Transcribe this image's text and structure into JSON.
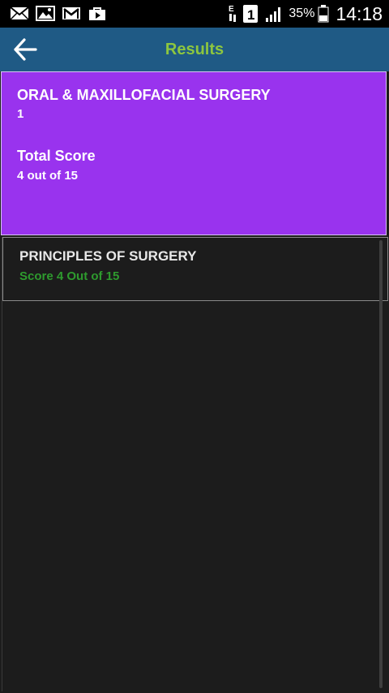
{
  "status_bar": {
    "left_icons": [
      "mail-icon",
      "image-icon",
      "gmail-icon",
      "shopping-bag-icon"
    ],
    "battery_percent": "35%",
    "time": "14:18"
  },
  "app_bar": {
    "title": "Results",
    "back_icon": "back-arrow-icon"
  },
  "summary": {
    "subject": "ORAL & MAXILLOFACIAL SURGERY",
    "number": "1",
    "total_label": "Total Score",
    "total_value": "4 out of 15"
  },
  "results": [
    {
      "title": "PRINCIPLES OF SURGERY",
      "score": "Score 4 Out of 15"
    }
  ],
  "colors": {
    "app_bar": "#1f5a85",
    "title": "#8dc63f",
    "summary_bg": "#9933ee",
    "score_green": "#2e9b2e",
    "background": "#1c1c1c"
  }
}
